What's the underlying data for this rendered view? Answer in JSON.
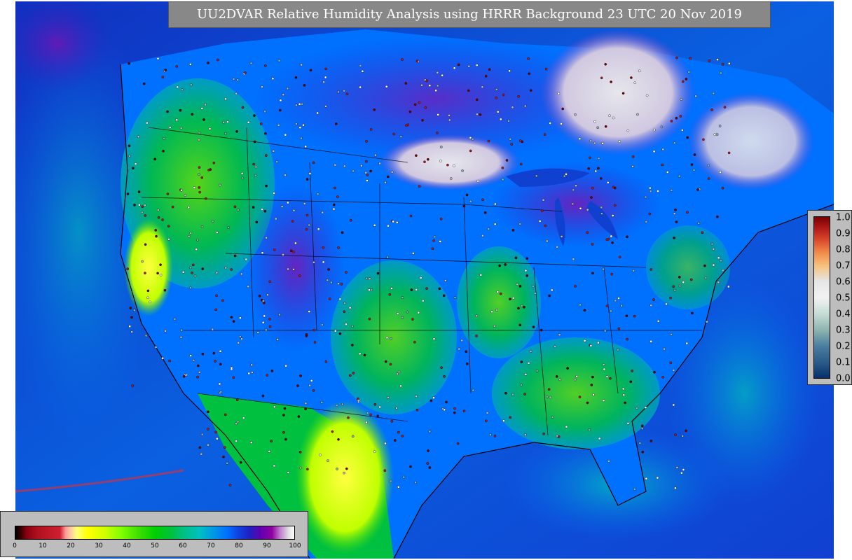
{
  "title": "UU2DVAR Relative Humidity Analysis using HRRR Background 23 UTC 20 Nov 2019",
  "colors": {
    "ocean": "#1a3ad0",
    "land_green": "#00c040",
    "snow": "#d9d9e0",
    "purple": "#7a00b0"
  },
  "rh_colorbar": {
    "ticks": [
      "0",
      "10",
      "20",
      "30",
      "40",
      "50",
      "60",
      "70",
      "80",
      "90",
      "100"
    ]
  },
  "qc_colorbar": {
    "ticks": [
      "1.0",
      "0.9",
      "0.8",
      "0.7",
      "0.6",
      "0.5",
      "0.4",
      "0.3",
      "0.2",
      "0.1",
      "0.0"
    ]
  }
}
